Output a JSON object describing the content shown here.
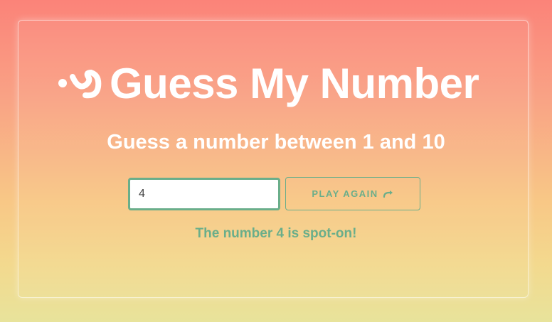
{
  "header": {
    "logo_icon": "wavy-dot-logo-icon",
    "title": "Guess My Number",
    "subtitle": "Guess a number between 1 and 10"
  },
  "game": {
    "input_value": "4",
    "play_again_label": "PLAY AGAIN",
    "play_again_icon": "redo-arrow-icon",
    "result_message": "The number 4 is spot-on!"
  },
  "colors": {
    "accent_green": "#6aae8a",
    "text_white": "#ffffff",
    "gradient_top": "#fb8379",
    "gradient_bottom": "#e8e39b"
  }
}
